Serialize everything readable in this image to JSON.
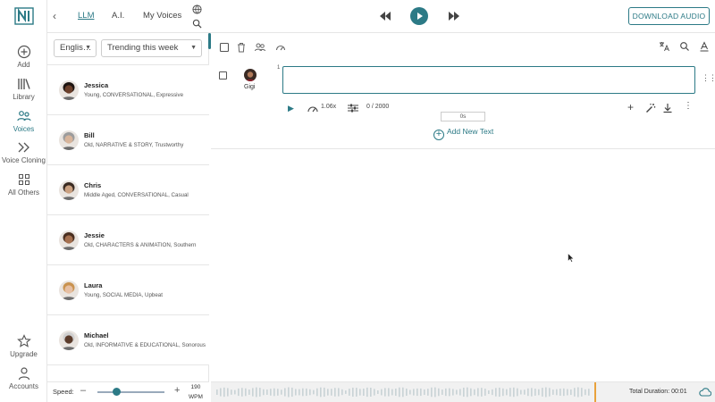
{
  "app": {
    "logo_icon": "brand-logo-icon"
  },
  "rail": {
    "items": [
      {
        "label": "Add",
        "icon": "plus-circle-icon"
      },
      {
        "label": "Library",
        "icon": "books-icon"
      },
      {
        "label": "Voices",
        "icon": "voices-icon",
        "active": true
      },
      {
        "label": "Voice Cloning",
        "icon": "voice-clone-icon"
      },
      {
        "label": "All Others",
        "icon": "grid-icon"
      }
    ],
    "bottom": [
      {
        "label": "Upgrade",
        "icon": "star-icon"
      },
      {
        "label": "Accounts",
        "icon": "user-icon"
      }
    ]
  },
  "topbar": {
    "tabs": [
      {
        "label": "LLM",
        "active": true
      },
      {
        "label": "A.I.",
        "active": false
      },
      {
        "label": "My Voices",
        "active": false
      }
    ],
    "download_label": "DOWNLOAD AUDIO"
  },
  "filters": {
    "language": "Englis…",
    "sort": "Trending this week"
  },
  "voices": [
    {
      "name": "Jessica",
      "desc": "Young, CONVERSATIONAL, Expressive",
      "skin": "#6b3f2a",
      "hair": "#1d1410"
    },
    {
      "name": "Bill",
      "desc": "Old, NARRATIVE & STORY, Trustworthy",
      "skin": "#d7b49a",
      "hair": "#9c9c9c"
    },
    {
      "name": "Chris",
      "desc": "Middle Aged, CONVERSATIONAL, Casual",
      "skin": "#caa080",
      "hair": "#3a2b22"
    },
    {
      "name": "Jessie",
      "desc": "Old, CHARACTERS & ANIMATION, Southern",
      "skin": "#a5704f",
      "hair": "#4a2f20"
    },
    {
      "name": "Laura",
      "desc": "Young, SOCIAL MEDIA, Upbeat",
      "skin": "#e6bfa3",
      "hair": "#c9924f"
    },
    {
      "name": "Michael",
      "desc": "Old, INFORMATIVE & EDUCATIONAL, Sonorous",
      "skin": "#5b3b2a",
      "hair": "#cfcfcf"
    }
  ],
  "speed": {
    "label": "Speed:",
    "minus": "–",
    "plus": "+",
    "value": "190",
    "unit": "WPM",
    "level": 0.28
  },
  "editor": {
    "row": {
      "number": "1",
      "voice": "Gigi",
      "speed": "1.06x",
      "count": "0 / 2000",
      "duration": "0s"
    },
    "add_text": "Add New Text"
  },
  "footer": {
    "total_duration": "Total Duration: 00:01"
  },
  "colors": {
    "accent": "#2c7a86",
    "playhead": "#e9a23b"
  }
}
